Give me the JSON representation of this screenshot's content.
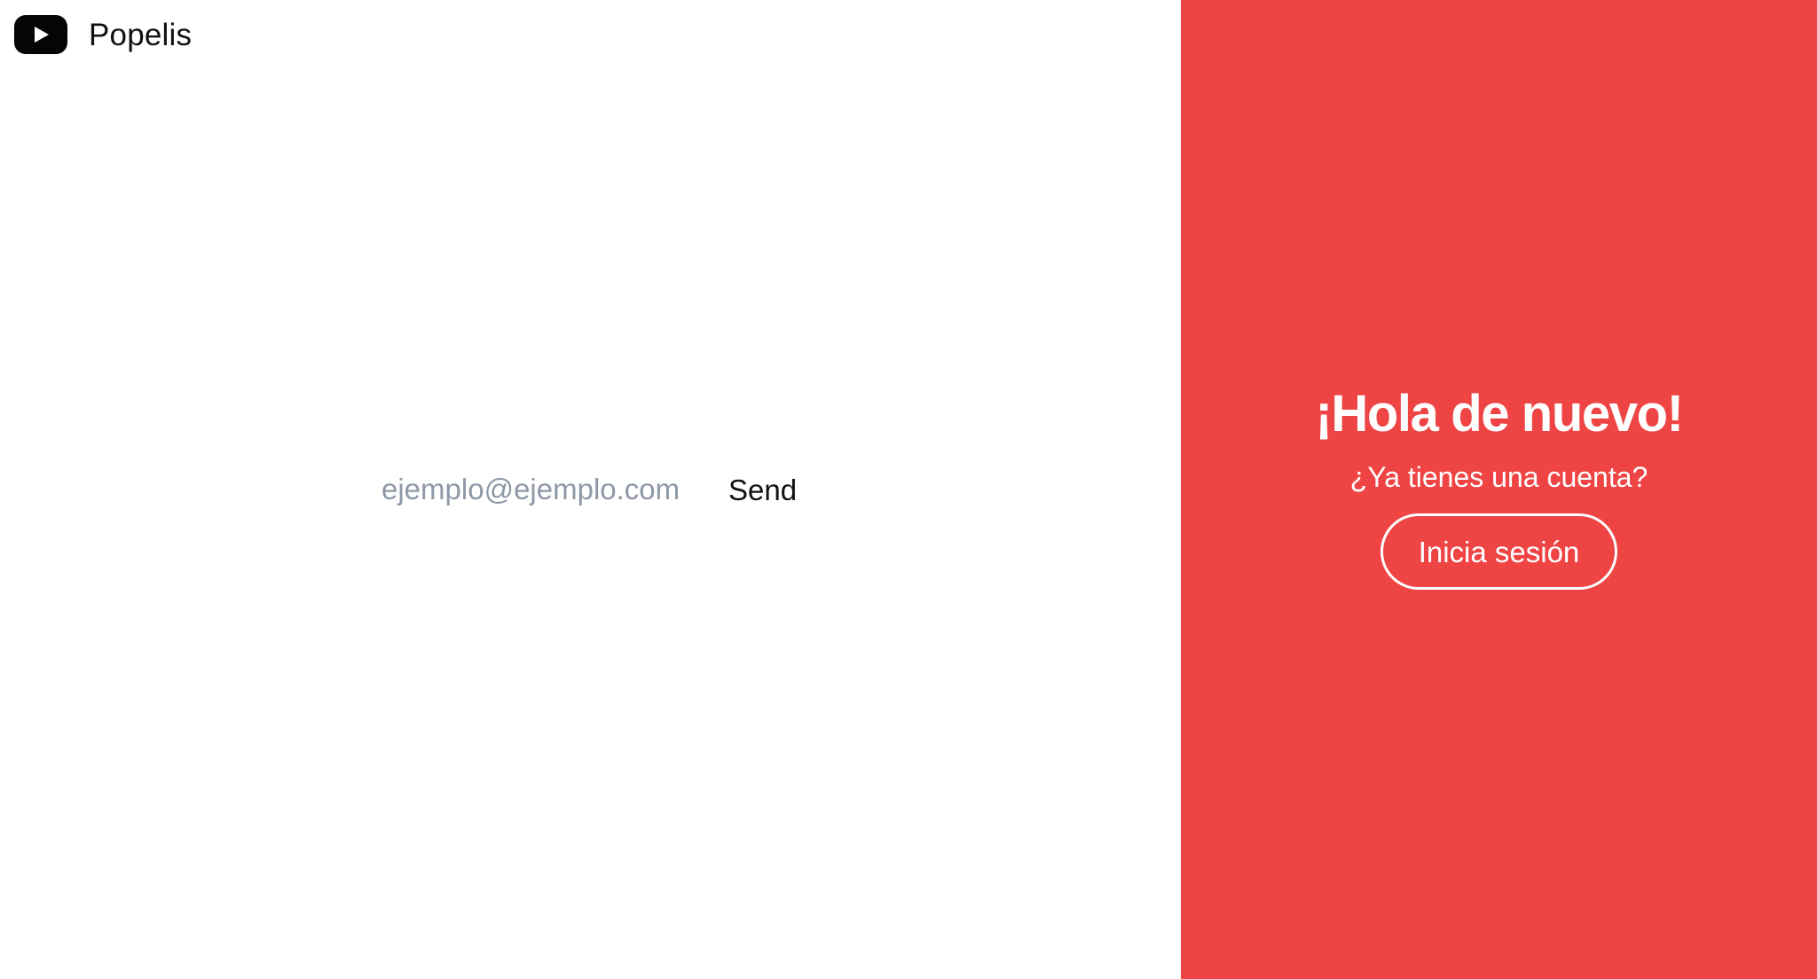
{
  "brand": {
    "icon": "play-icon",
    "name": "Popelis"
  },
  "email_form": {
    "placeholder": "ejemplo@ejemplo.com",
    "value": "",
    "send_label": "Send"
  },
  "welcome_panel": {
    "title": "¡Hola de nuevo!",
    "subtitle": "¿Ya tienes una cuenta?",
    "login_label": "Inicia sesión"
  },
  "colors": {
    "accent": "#ef4444",
    "text": "#111111",
    "placeholder": "#8f98a7",
    "background": "#ffffff"
  }
}
